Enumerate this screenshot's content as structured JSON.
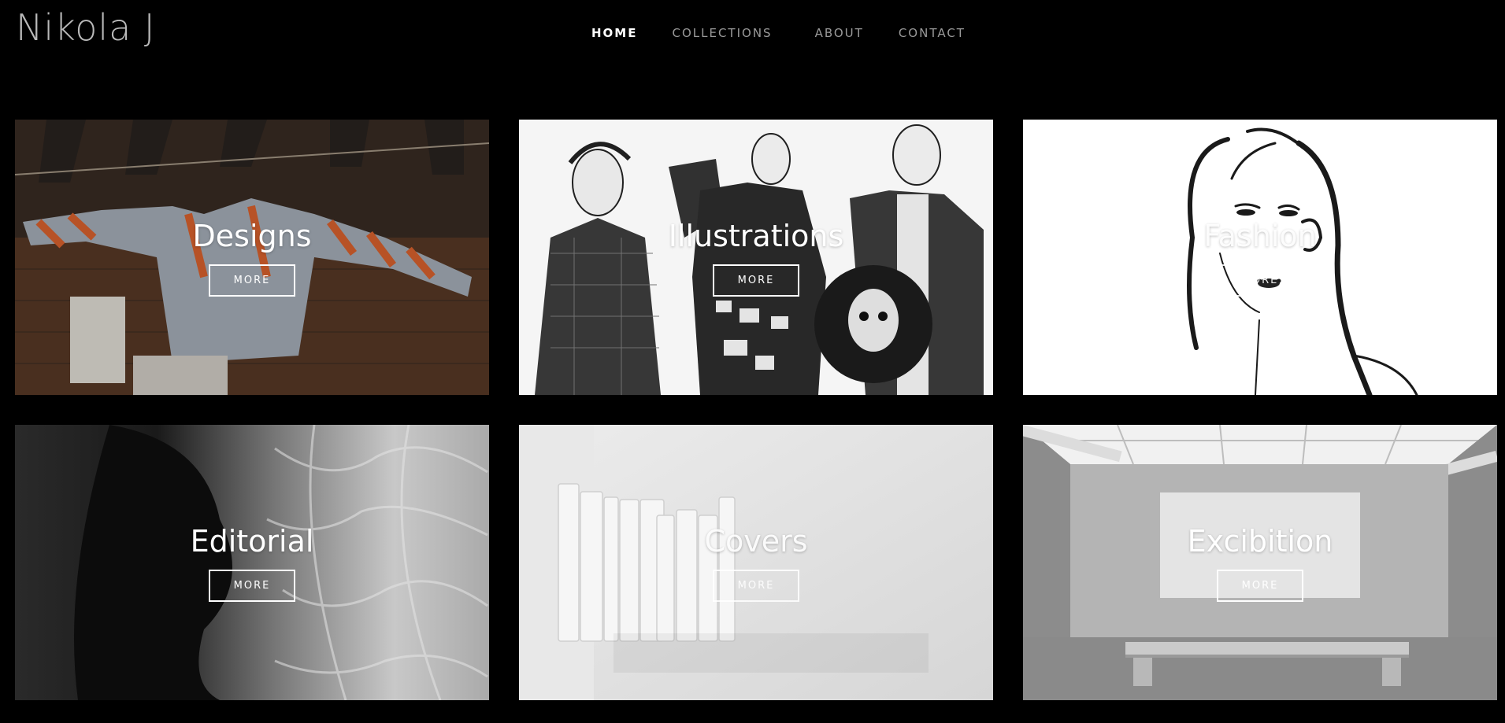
{
  "brand": {
    "logo": "Nikola J"
  },
  "nav": {
    "home": "HOME",
    "collections": "COLLECTIONS",
    "about": "ABOUT",
    "contact": "CONTACT"
  },
  "tiles": [
    {
      "title": "Designs",
      "button": "MORE"
    },
    {
      "title": "Illustrations",
      "button": "MORE"
    },
    {
      "title": "Fashion",
      "button": "MORE"
    },
    {
      "title": "Editorial",
      "button": "MORE"
    },
    {
      "title": "Covers",
      "button": "MORE"
    },
    {
      "title": "Excibition",
      "button": "MORE"
    }
  ],
  "colors": {
    "background": "#000000",
    "nav_active": "#ffffff",
    "nav_inactive": "#9a9a9a",
    "logo": "#b9b9b9"
  }
}
